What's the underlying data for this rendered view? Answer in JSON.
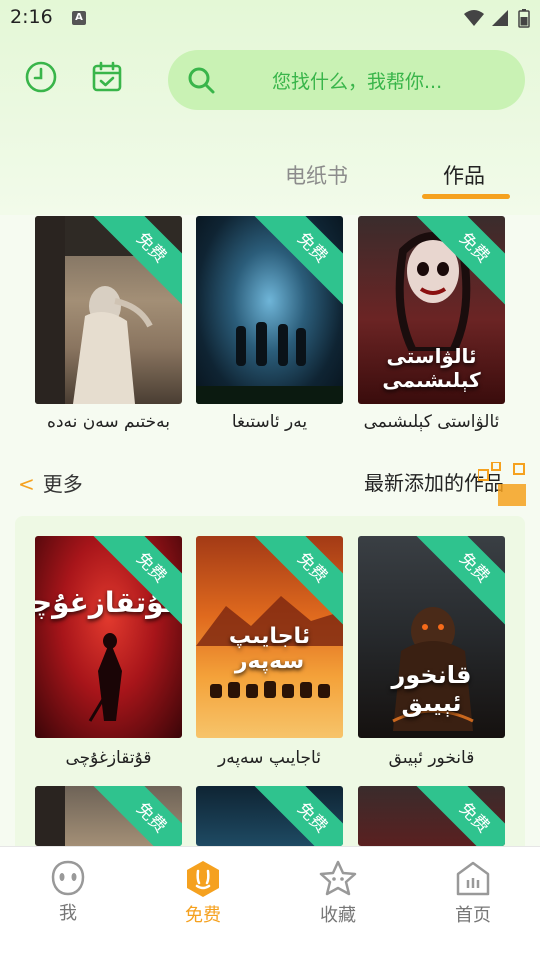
{
  "status_bar": {
    "time": "2:16",
    "a_badge": "A"
  },
  "header": {
    "search_placeholder": "您找什么，我帮你..."
  },
  "tabs": [
    {
      "label": "电纸书",
      "active": false
    },
    {
      "label": "作品",
      "active": true
    }
  ],
  "free_badge": "免费",
  "top_books": [
    {
      "title": "بەختىم سەن نەدە"
    },
    {
      "title": "يەر ئاستىغا"
    },
    {
      "title": "ئالۋاستى كېلىشىمى",
      "cover_text": "ئالۋاستى كېلىشىمى"
    }
  ],
  "section": {
    "more_label": "更多",
    "title": "最新添加的作品"
  },
  "new_books": [
    {
      "title": "قۇتقازغۇچى",
      "cover_text": "قۇتقازغۇچى"
    },
    {
      "title": "ئاجايىپ سەپەر",
      "cover_text": "ئاجايىپ سەپەر"
    },
    {
      "title": "قانخور ئېيىق",
      "cover_text": "قانخور ئېيىق"
    }
  ],
  "bottom_nav": [
    {
      "label": "我",
      "icon": "face-icon",
      "active": false
    },
    {
      "label": "免费",
      "icon": "rabbit-icon",
      "active": true
    },
    {
      "label": "收藏",
      "icon": "star-icon",
      "active": false
    },
    {
      "label": "首页",
      "icon": "home-icon",
      "active": false
    }
  ],
  "colors": {
    "accent": "#f5a11f",
    "green": "#39b54a",
    "badge": "#2fc38e"
  }
}
